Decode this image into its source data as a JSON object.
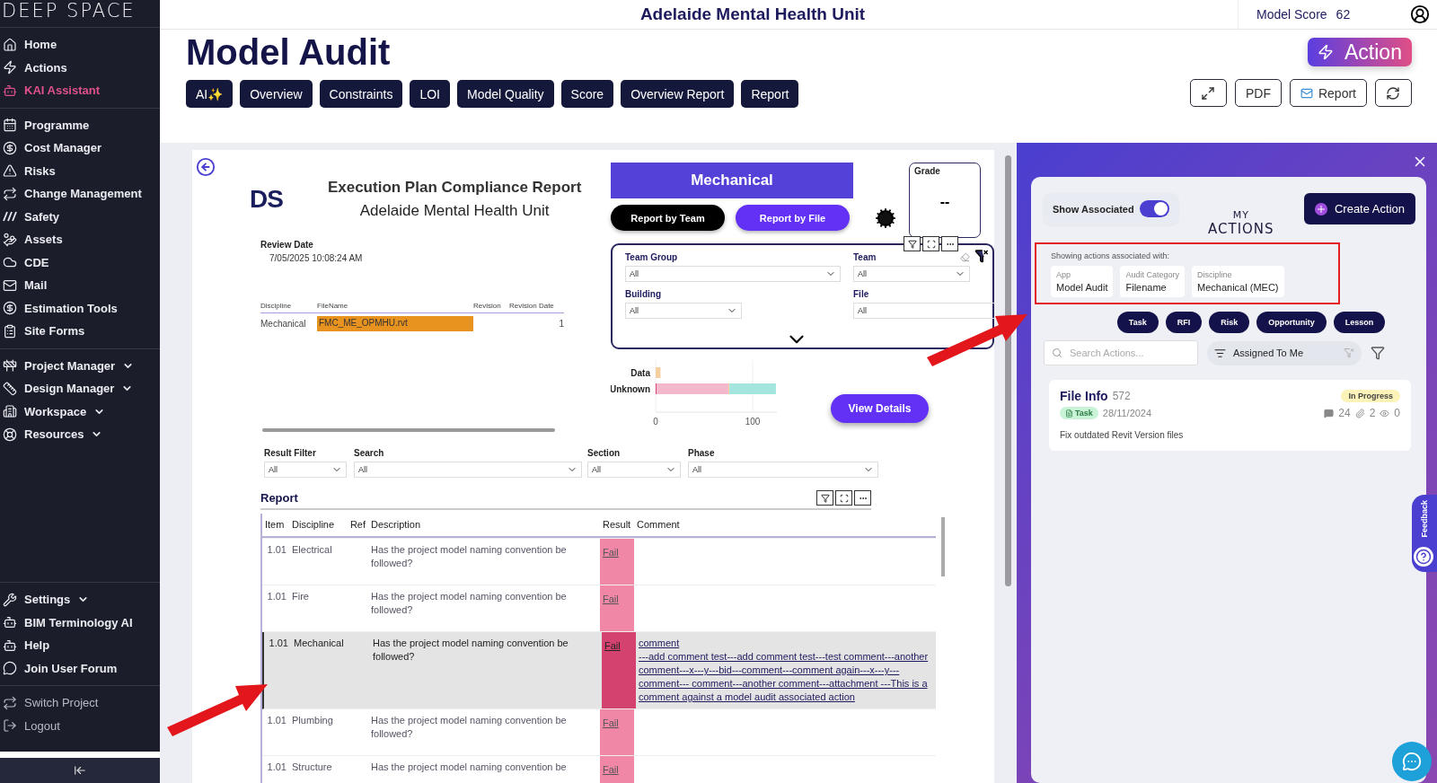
{
  "sidebar": {
    "logo": "DEEP SPACE",
    "groups": [
      {
        "items": [
          {
            "label": "Home",
            "selected": false,
            "has_menu": false
          },
          {
            "label": "Actions",
            "selected": false,
            "has_menu": false
          },
          {
            "label": "KAI Assistant",
            "selected": true,
            "has_menu": false
          }
        ]
      },
      {
        "items": [
          {
            "label": "Programme",
            "selected": false,
            "has_menu": false
          },
          {
            "label": "Cost Manager",
            "selected": false,
            "has_menu": false
          },
          {
            "label": "Risks",
            "selected": false,
            "has_menu": false
          },
          {
            "label": "Change Management",
            "selected": false,
            "has_menu": false
          },
          {
            "label": "Safety",
            "selected": false,
            "has_menu": false
          },
          {
            "label": "Assets",
            "selected": false,
            "has_menu": false
          },
          {
            "label": "CDE",
            "selected": false,
            "has_menu": false
          },
          {
            "label": "Mail",
            "selected": false,
            "has_menu": false
          },
          {
            "label": "Estimation Tools",
            "selected": false,
            "has_menu": false
          },
          {
            "label": "Site Forms",
            "selected": false,
            "has_menu": false
          }
        ]
      },
      {
        "items": [
          {
            "label": "Project Manager",
            "selected": false,
            "has_menu": true
          },
          {
            "label": "Design Manager",
            "selected": false,
            "has_menu": true
          },
          {
            "label": "Workspace",
            "selected": false,
            "has_menu": true
          },
          {
            "label": "Resources",
            "selected": false,
            "has_menu": true
          }
        ]
      }
    ],
    "bottom_groups": [
      {
        "items": [
          {
            "label": "Settings",
            "selected": false,
            "has_menu": true
          },
          {
            "label": "BIM Terminology AI",
            "selected": false,
            "has_menu": false
          },
          {
            "label": "Help",
            "selected": false,
            "has_menu": false
          },
          {
            "label": "Join User Forum",
            "selected": false,
            "has_menu": false
          }
        ]
      },
      {
        "items": [
          {
            "label": "Switch Project",
            "selected": false,
            "has_menu": false
          },
          {
            "label": "Logout",
            "selected": false,
            "has_menu": false
          }
        ]
      }
    ]
  },
  "header": {
    "project": "Adelaide Mental Health Unit",
    "score_label": "Model Score",
    "score": "62"
  },
  "page": {
    "title": "Model Audit",
    "action_button": "Action",
    "tabs": [
      {
        "label": "AI✨",
        "selected": false
      },
      {
        "label": "Overview",
        "selected": false
      },
      {
        "label": "Constraints",
        "selected": false
      },
      {
        "label": "LOI",
        "selected": false
      },
      {
        "label": "Model Quality",
        "selected": false
      },
      {
        "label": "Score",
        "selected": false
      },
      {
        "label": "Overview Report",
        "selected": false
      },
      {
        "label": "Report",
        "selected": false
      }
    ],
    "toolbar": [
      {
        "kind": "expand"
      },
      {
        "kind": "text",
        "label": "PDF"
      },
      {
        "kind": "mail",
        "label": "Report"
      },
      {
        "kind": "refresh"
      }
    ]
  },
  "report": {
    "logo": "DS",
    "title": "Execution Plan Compliance Report",
    "subtitle": "Adelaide Mental Health Unit",
    "review_date_label": "Review Date",
    "review_date": "7/05/2025 10:08:24 AM",
    "files": {
      "columns": [
        "Discipline",
        "FileName",
        "Revision",
        "Revision Date"
      ],
      "rows": [
        [
          "Mechanical",
          "FMC_ME_OPMHU.rvt",
          "",
          "1"
        ]
      ]
    },
    "discipline": "Mechanical",
    "mode_buttons": [
      {
        "label": "Report by Team",
        "selected": false
      },
      {
        "label": "Report by File",
        "selected": true
      }
    ],
    "grade_label": "Grade",
    "grade": "--",
    "filters": [
      {
        "label": "Team Group",
        "value": "All"
      },
      {
        "label": "Team",
        "value": "All"
      },
      {
        "label": "Building",
        "value": "All"
      },
      {
        "label": "File",
        "value": "All"
      }
    ],
    "chart_data": {
      "type": "bar",
      "orientation": "horizontal",
      "stacked": true,
      "categories": [
        "Data",
        "Unknown"
      ],
      "xticks": [
        0,
        100
      ],
      "xlim": [
        0,
        125
      ],
      "series": [
        {
          "color": "#e0446f",
          "values": [
            0,
            1
          ]
        },
        {
          "color": "#f4b8cc",
          "values": [
            0,
            74
          ]
        },
        {
          "color": "#f5cfa0",
          "values": [
            5,
            1
          ]
        },
        {
          "color": "#a4e6df",
          "values": [
            0,
            48
          ]
        }
      ]
    },
    "view_details": "View Details",
    "table_filters": [
      {
        "label": "Result Filter",
        "value": "All"
      },
      {
        "label": "Search",
        "value": "All"
      },
      {
        "label": "Section",
        "value": "All"
      },
      {
        "label": "Phase",
        "value": "All"
      }
    ],
    "table": {
      "title": "Report",
      "columns": [
        "Item",
        "Discipline",
        "Ref",
        "Description",
        "Result",
        "Comment"
      ],
      "rows": [
        {
          "item": "1.01",
          "discipline": "Electrical",
          "ref": "",
          "description": "Has the project model naming convention be followed?",
          "result": "Fail",
          "comment": [],
          "selected": false
        },
        {
          "item": "1.01",
          "discipline": "Fire",
          "ref": "",
          "description": "Has the project model naming convention be followed?",
          "result": "Fail",
          "comment": [],
          "selected": false
        },
        {
          "item": "1.01",
          "discipline": "Mechanical",
          "ref": "",
          "description": "Has the project model naming convention be followed?",
          "result": "Fail",
          "comment": [
            "comment",
            "---add comment test---add comment test---test comment---another comment---x---y---bid---comment---comment again---x---y---comment--- comment---another comment---attachment ---This is a comment against a model audit associated action"
          ],
          "selected": true
        },
        {
          "item": "1.01",
          "discipline": "Plumbing",
          "ref": "",
          "description": "Has the project model naming convention be followed?",
          "result": "Fail",
          "comment": [],
          "selected": false
        },
        {
          "item": "1.01",
          "discipline": "Structure",
          "ref": "",
          "description": "Has the project model naming convention be",
          "result": "Fail",
          "comment": [],
          "selected": false
        }
      ]
    }
  },
  "actions_panel": {
    "show_associated_label": "Show Associated",
    "show_associated": true,
    "title": [
      "MY",
      "ACTIONS"
    ],
    "create_button": "Create Action",
    "associated": {
      "label": "Showing actions associated with:",
      "highlighted": true,
      "chips": [
        {
          "label": "App",
          "value": "Model Audit"
        },
        {
          "label": "Audit Category",
          "value": "Filename"
        },
        {
          "label": "Discipline",
          "value": "Mechanical (MEC)"
        }
      ]
    },
    "types": [
      "Task",
      "RFI",
      "Risk",
      "Opportunity",
      "Lesson"
    ],
    "search": {
      "placeholder": "Search Actions..."
    },
    "assigned_filter": "Assigned To Me",
    "cards": [
      {
        "title": "File Info",
        "number": "572",
        "status": "In Progress",
        "tag": "Task",
        "date": "28/11/2024",
        "comments": "24",
        "attachments": "2",
        "views": "0",
        "description": "Fix outdated Revit Version files"
      }
    ],
    "feedback": "Feedback"
  },
  "annotations": [
    {
      "kind": "arrow"
    },
    {
      "kind": "arrow"
    }
  ]
}
